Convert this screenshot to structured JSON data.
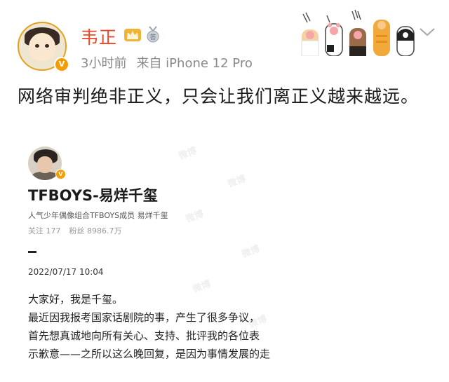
{
  "post": {
    "username": "韦正",
    "time": "3小时前",
    "source": "来自 iPhone 12 Pro",
    "text": "网络审判绝非正义，只会让我们离正义越来越远。",
    "verified_mark": "V",
    "medal_text": "答"
  },
  "quoted": {
    "name": "TFBOYS-易烊千玺",
    "bio": "人气少年偶像组合TFBOYS成员 易烊千玺",
    "follow": "关注 177",
    "fans": "粉丝 8986.7万",
    "date": "2022/07/17 10:04",
    "verified_mark": "V",
    "lines": [
      "大家好，我是千玺。",
      "最近因我报考国家话剧院的事，产生了很多争议，",
      "首先想真诚地向所有关心、支持、批评我的各位表",
      "示歉意——之所以这么晚回复，是因为事情发展的走"
    ]
  },
  "icons": {
    "avatar": "user-avatar",
    "vip": "vip-crown-icon",
    "medal": "medal-icon",
    "paws": "cat-paw-decoration",
    "more": "chevron-down-icon"
  },
  "colors": {
    "username": "#e8472a",
    "verified": "#f59c00",
    "meta": "#8a8a8a"
  }
}
